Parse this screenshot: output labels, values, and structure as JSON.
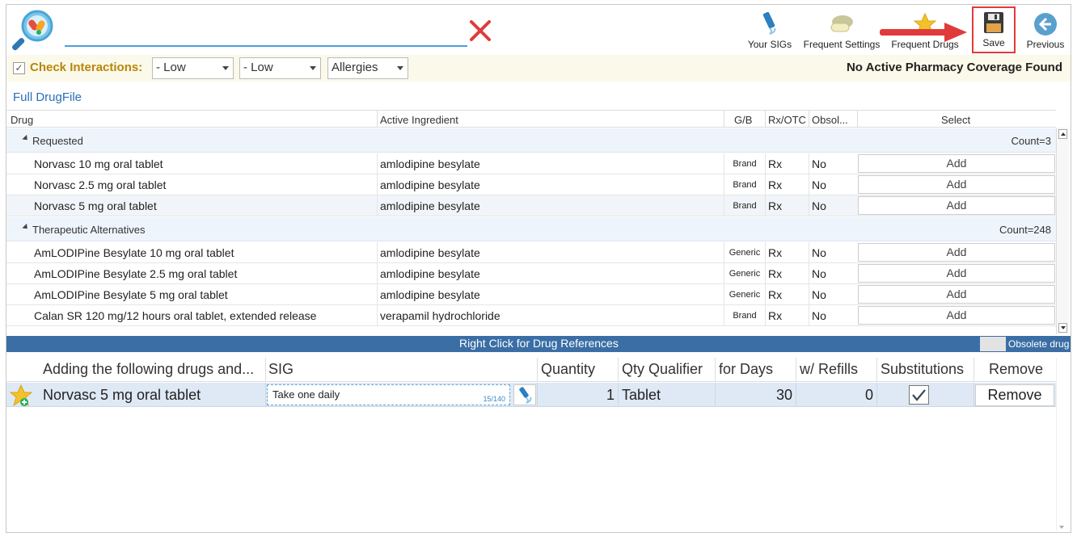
{
  "toolbar": {
    "search_placeholder": "",
    "your_sigs": "Your SIGs",
    "frequent_settings": "Frequent Settings",
    "frequent_drugs": "Frequent Drugs",
    "save": "Save",
    "previous": "Previous"
  },
  "filters": {
    "check_interactions_label": "Check Interactions:",
    "check_interactions_checked": true,
    "severity1": "- Low",
    "severity2": "- Low",
    "allergies": "Allergies",
    "coverage_status": "No Active Pharmacy Coverage Found"
  },
  "drugfile": {
    "title": "Full DrugFile",
    "columns": {
      "drug": "Drug",
      "ingredient": "Active Ingredient",
      "gb": "G/B",
      "rxotc": "Rx/OTC",
      "obsolete": "Obsol...",
      "select": "Select"
    },
    "groups": [
      {
        "name": "Requested",
        "count": "Count=3",
        "rows": [
          {
            "drug": "Norvasc 10 mg oral tablet",
            "ingredient": "amlodipine besylate",
            "gb": "Brand",
            "rx": "Rx",
            "obs": "No",
            "action": "Add"
          },
          {
            "drug": "Norvasc 2.5 mg oral tablet",
            "ingredient": "amlodipine besylate",
            "gb": "Brand",
            "rx": "Rx",
            "obs": "No",
            "action": "Add"
          },
          {
            "drug": "Norvasc 5 mg oral tablet",
            "ingredient": "amlodipine besylate",
            "gb": "Brand",
            "rx": "Rx",
            "obs": "No",
            "action": "Add"
          }
        ]
      },
      {
        "name": "Therapeutic Alternatives",
        "count": "Count=248",
        "rows": [
          {
            "drug": "AmLODIPine Besylate 10 mg oral tablet",
            "ingredient": "amlodipine besylate",
            "gb": "Generic",
            "rx": "Rx",
            "obs": "No",
            "action": "Add"
          },
          {
            "drug": "AmLODIPine Besylate 2.5 mg oral tablet",
            "ingredient": "amlodipine besylate",
            "gb": "Generic",
            "rx": "Rx",
            "obs": "No",
            "action": "Add"
          },
          {
            "drug": "AmLODIPine Besylate 5 mg oral tablet",
            "ingredient": "amlodipine besylate",
            "gb": "Generic",
            "rx": "Rx",
            "obs": "No",
            "action": "Add"
          },
          {
            "drug": "Calan SR 120 mg/12 hours oral tablet, extended release",
            "ingredient": "verapamil hydrochloride",
            "gb": "Brand",
            "rx": "Rx",
            "obs": "No",
            "action": "Add"
          }
        ]
      }
    ]
  },
  "bluebar": {
    "hint": "Right Click for Drug References",
    "legend": "Obsolete drug"
  },
  "selected": {
    "columns": {
      "drug": "Adding the following drugs and...",
      "sig": "SIG",
      "quantity": "Quantity",
      "qty_qualifier": "Qty Qualifier",
      "for_days": "for Days",
      "refills": "w/ Refills",
      "substitutions": "Substitutions",
      "remove": "Remove"
    },
    "row": {
      "drug": "Norvasc 5 mg oral tablet",
      "sig": "Take one daily",
      "sig_count": "15/140",
      "quantity": "1",
      "qty_qualifier": "Tablet",
      "for_days": "30",
      "refills": "0",
      "substitutions_checked": true,
      "remove": "Remove"
    }
  },
  "colors": {
    "accent_blue": "#3a6ea5",
    "link_blue": "#2a6ebb",
    "highlight_red": "#e03b3b",
    "check_label_gold": "#b8860b"
  }
}
